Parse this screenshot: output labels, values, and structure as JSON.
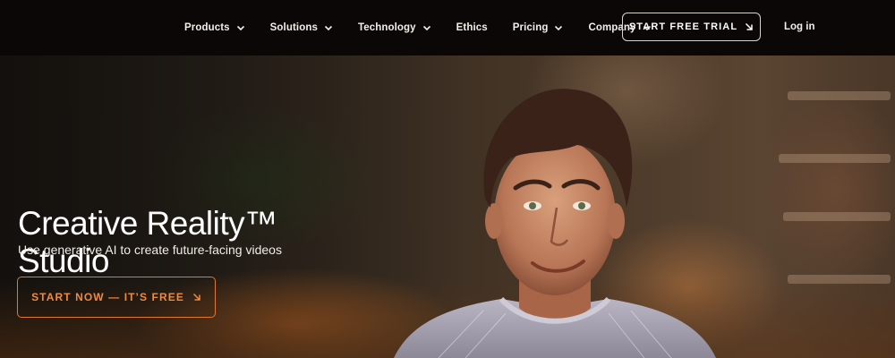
{
  "nav": {
    "items": [
      {
        "label": "Products",
        "has_dropdown": true
      },
      {
        "label": "Solutions",
        "has_dropdown": true
      },
      {
        "label": "Technology",
        "has_dropdown": true
      },
      {
        "label": "Ethics",
        "has_dropdown": false
      },
      {
        "label": "Pricing",
        "has_dropdown": true
      },
      {
        "label": "Company",
        "has_dropdown": true
      }
    ],
    "trial_button": "START FREE TRIAL",
    "login": "Log in",
    "icons": {
      "dropdown": "chevron-down-icon",
      "cta_arrow": "arrow-down-right-icon"
    }
  },
  "hero": {
    "title_line1": "Creative Reality™",
    "title_line2": "Studio",
    "subtitle": "Use generative AI to create future-facing videos",
    "cta": "START NOW — IT’S FREE",
    "accent_color": "#e0782f"
  }
}
